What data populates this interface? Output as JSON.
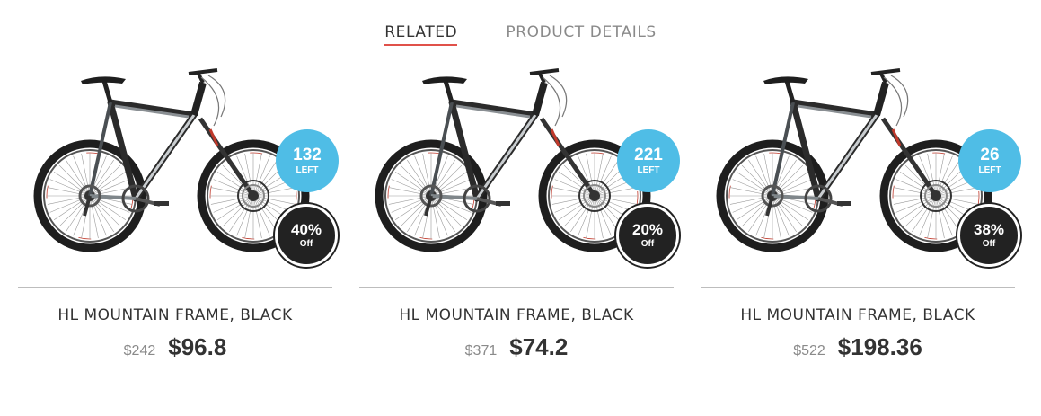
{
  "tabs": [
    {
      "label": "RELATED",
      "active": true
    },
    {
      "label": "PRODUCT DETAILS",
      "active": false
    }
  ],
  "colors": {
    "accent": "#e0514a",
    "stock_badge": "#4fbde6",
    "discount_badge": "#222222"
  },
  "products": [
    {
      "name": "HL MOUNTAIN FRAME, BLACK",
      "old_price": "$242",
      "new_price": "$96.8",
      "stock": "132",
      "stock_label": "LEFT",
      "discount": "40%",
      "discount_label": "Off",
      "image_icon": "mountain-bike"
    },
    {
      "name": "HL MOUNTAIN FRAME, BLACK",
      "old_price": "$371",
      "new_price": "$74.2",
      "stock": "221",
      "stock_label": "LEFT",
      "discount": "20%",
      "discount_label": "Off",
      "image_icon": "mountain-bike"
    },
    {
      "name": "HL MOUNTAIN FRAME, BLACK",
      "old_price": "$522",
      "new_price": "$198.36",
      "stock": "26",
      "stock_label": "LEFT",
      "discount": "38%",
      "discount_label": "Off",
      "image_icon": "mountain-bike"
    }
  ]
}
